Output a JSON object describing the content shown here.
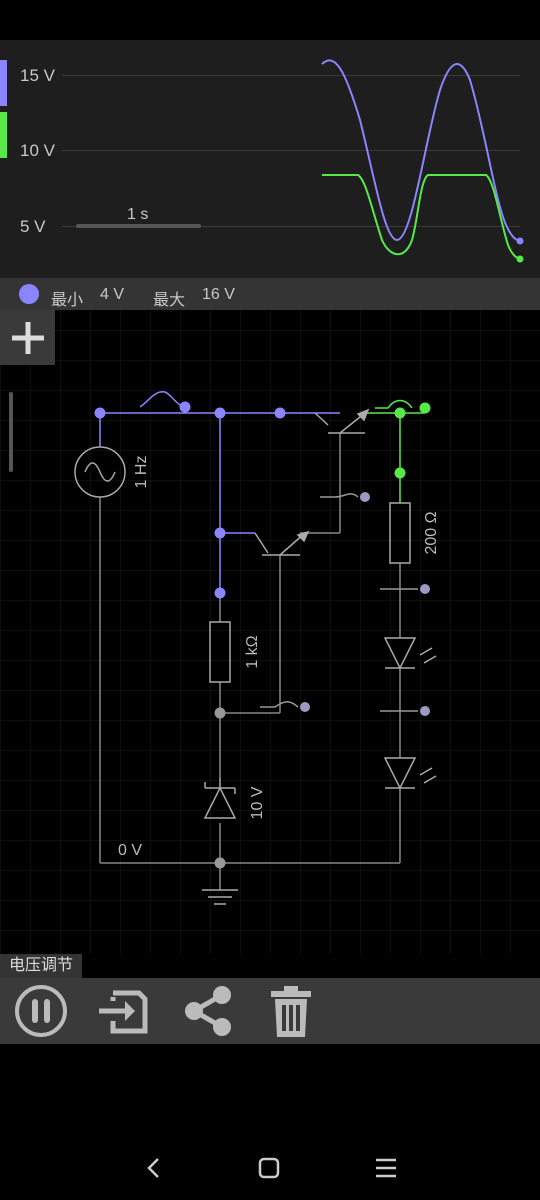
{
  "scope": {
    "y_labels": [
      "15 V",
      "10 V",
      "5 V"
    ],
    "time_scale": "1 s",
    "series_colors": [
      "#8a85ff",
      "#57e84a"
    ]
  },
  "minmax": {
    "min_label": "最小",
    "min_value": "4 V",
    "max_label": "最大",
    "max_value": "16 V"
  },
  "circuit": {
    "source_freq": "1 Hz",
    "resistor_1": "1 kΩ",
    "resistor_2": "200 Ω",
    "zener": "10 V",
    "ground": "0 V"
  },
  "mode_label": "电压调节",
  "toolbar": {
    "icons": [
      "pause-icon",
      "export-icon",
      "share-icon",
      "trash-icon"
    ]
  },
  "nav": {
    "icons": [
      "back-icon",
      "home-icon",
      "menu-icon"
    ]
  }
}
